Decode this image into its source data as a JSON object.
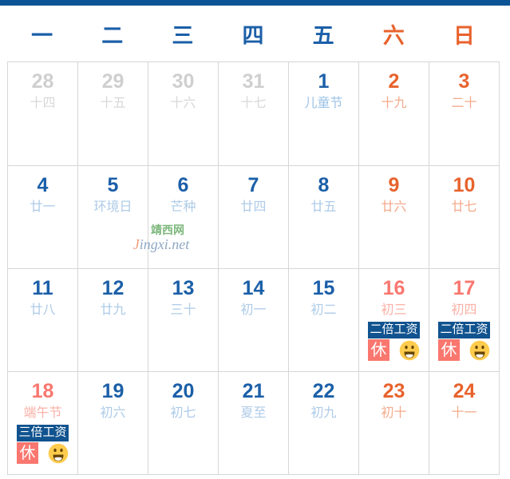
{
  "theme": {
    "top_bar_color": "#0b5394",
    "weekday_color": "#1b5fa8",
    "weekend_color": "#e8622c",
    "holiday_color": "#f9776f",
    "outside_color": "#cfcfcf",
    "wage_badge_bg": "#11538f",
    "rest_badge_bg": "#f9776f",
    "grid_line_color": "#d6d6d6"
  },
  "header": {
    "weekdays": [
      {
        "label": "一",
        "type": "weekday"
      },
      {
        "label": "二",
        "type": "weekday"
      },
      {
        "label": "三",
        "type": "weekday"
      },
      {
        "label": "四",
        "type": "weekday"
      },
      {
        "label": "五",
        "type": "weekday"
      },
      {
        "label": "六",
        "type": "weekend"
      },
      {
        "label": "日",
        "type": "weekend"
      }
    ]
  },
  "watermark": {
    "chinese": "靖西网",
    "initial": "J",
    "latin_rest": "ingxi.net"
  },
  "badge_labels": {
    "double_wage": "二倍工资",
    "triple_wage": "三倍工资",
    "rest": "休",
    "emoji_name": "smiling-face-open-mouth"
  },
  "weeks": [
    [
      {
        "day": "28",
        "sub": "十四",
        "style": "out"
      },
      {
        "day": "29",
        "sub": "十五",
        "style": "out"
      },
      {
        "day": "30",
        "sub": "十六",
        "style": "out"
      },
      {
        "day": "31",
        "sub": "十七",
        "style": "out"
      },
      {
        "day": "1",
        "sub": "儿童节",
        "style": "weekday",
        "sub_festival": true
      },
      {
        "day": "2",
        "sub": "十九",
        "style": "weekend"
      },
      {
        "day": "3",
        "sub": "二十",
        "style": "weekend"
      }
    ],
    [
      {
        "day": "4",
        "sub": "廿一",
        "style": "weekday"
      },
      {
        "day": "5",
        "sub": "环境日",
        "style": "weekday"
      },
      {
        "day": "6",
        "sub": "芒种",
        "style": "weekday"
      },
      {
        "day": "7",
        "sub": "廿四",
        "style": "weekday"
      },
      {
        "day": "8",
        "sub": "廿五",
        "style": "weekday"
      },
      {
        "day": "9",
        "sub": "廿六",
        "style": "weekend"
      },
      {
        "day": "10",
        "sub": "廿七",
        "style": "weekend"
      }
    ],
    [
      {
        "day": "11",
        "sub": "廿八",
        "style": "weekday"
      },
      {
        "day": "12",
        "sub": "廿九",
        "style": "weekday"
      },
      {
        "day": "13",
        "sub": "三十",
        "style": "weekday"
      },
      {
        "day": "14",
        "sub": "初一",
        "style": "weekday"
      },
      {
        "day": "15",
        "sub": "初二",
        "style": "weekday"
      },
      {
        "day": "16",
        "sub": "初三",
        "style": "holiday",
        "wage": "二倍工资",
        "rest": "休",
        "emoji": true
      },
      {
        "day": "17",
        "sub": "初四",
        "style": "holiday",
        "wage": "二倍工资",
        "rest": "休",
        "emoji": true
      }
    ],
    [
      {
        "day": "18",
        "sub": "端午节",
        "style": "holiday",
        "wage": "三倍工资",
        "rest": "休",
        "emoji": true
      },
      {
        "day": "19",
        "sub": "初六",
        "style": "weekday"
      },
      {
        "day": "20",
        "sub": "初七",
        "style": "weekday"
      },
      {
        "day": "21",
        "sub": "夏至",
        "style": "weekday"
      },
      {
        "day": "22",
        "sub": "初九",
        "style": "weekday"
      },
      {
        "day": "23",
        "sub": "初十",
        "style": "weekend"
      },
      {
        "day": "24",
        "sub": "十一",
        "style": "weekend"
      }
    ]
  ]
}
